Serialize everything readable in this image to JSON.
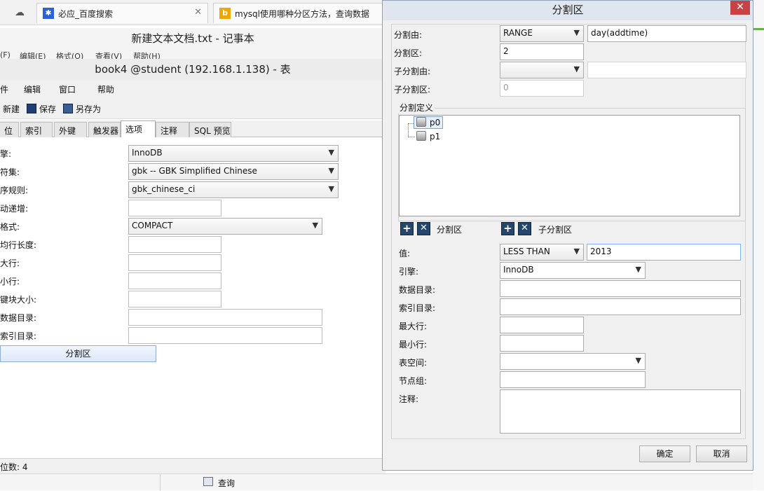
{
  "browser": {
    "tabs": [
      {
        "title": "必应_百度搜索"
      },
      {
        "title": "mysql使用哪种分区方法，查询数据"
      }
    ]
  },
  "notepad": {
    "title": "新建文本文档.txt - 记事本",
    "menu": [
      "(F)",
      "编辑(E)",
      "格式(O)",
      "查看(V)",
      "帮助(H)"
    ]
  },
  "navicat": {
    "title": "book4 @student (192.168.1.138) - 表",
    "menu": [
      "件",
      "编辑",
      "窗口",
      "帮助"
    ],
    "toolbar": {
      "new": "新建",
      "save": "保存",
      "save_as": "另存为"
    },
    "tabs": [
      "位",
      "索引",
      "外键",
      "触发器",
      "选项",
      "注释",
      "SQL 预览"
    ],
    "fields": {
      "engine_label": "擎:",
      "engine_value": "InnoDB",
      "charset_label": "符集:",
      "charset_value": "gbk -- GBK Simplified Chinese",
      "collation_label": "序规则:",
      "collation_value": "gbk_chinese_ci",
      "auto_inc_label": "动递增:",
      "auto_inc_value": "",
      "row_format_label": "格式:",
      "row_format_value": "COMPACT",
      "avg_row_label": "均行长度:",
      "avg_row_value": "",
      "max_rows_label": "大行:",
      "max_rows_value": "",
      "min_rows_label": "小行:",
      "min_rows_value": "",
      "key_block_label": "键块大小:",
      "key_block_value": "",
      "data_dir_label": "数据目录:",
      "data_dir_value": "",
      "index_dir_label": "索引目录:",
      "index_dir_value": ""
    },
    "partition_button": "分割区",
    "status": "位数: 4",
    "bottom_item": "查询"
  },
  "dialog": {
    "title": "分割区",
    "close": "✕",
    "partition_by_label": "分割由:",
    "partition_by_value": "RANGE",
    "partition_expr": "day(addtime)",
    "partitions_label": "分割区:",
    "partitions_value": "2",
    "subpartition_by_label": "子分割由:",
    "subpartition_by_value": "",
    "subpartition_expr": "",
    "subpartitions_label": "子分割区:",
    "subpartitions_value": "0",
    "definition_label": "分割定义",
    "tree": [
      "p0",
      "p1"
    ],
    "add_icon": "+",
    "remove_icon": "✕",
    "partition_label": "分割区",
    "subpartition_label": "子分割区",
    "value_label": "值:",
    "value_op": "LESS THAN",
    "value_value": "2013",
    "engine_label": "引擎:",
    "engine_value": "InnoDB",
    "data_dir_label": "数据目录:",
    "data_dir_value": "",
    "index_dir_label": "索引目录:",
    "index_dir_value": "",
    "max_rows_label": "最大行:",
    "max_rows_value": "",
    "min_rows_label": "最小行:",
    "min_rows_value": "",
    "tablespace_label": "表空间:",
    "tablespace_value": "",
    "nodegroup_label": "节点组:",
    "nodegroup_value": "",
    "comment_label": "注释:",
    "comment_value": "",
    "ok": "确定",
    "cancel": "取消"
  }
}
